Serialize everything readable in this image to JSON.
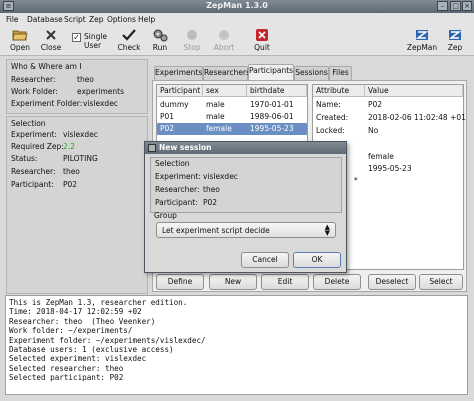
{
  "window": {
    "title": "ZepMan 1.3.0"
  },
  "menu": [
    "File",
    "Database",
    "Script",
    "Zep",
    "Options",
    "Help"
  ],
  "toolbar": {
    "open": "Open",
    "close": "Close",
    "single_user": "Single User",
    "check": "Check",
    "run": "Run",
    "stop": "Stop",
    "abort": "Abort",
    "quit": "Quit",
    "zepman": "ZepMan",
    "zep": "Zep",
    "single_user_checked": true
  },
  "who": {
    "heading": "Who & Where am I",
    "researcher_label": "Researcher:",
    "researcher": "theo",
    "work_folder_label": "Work Folder:",
    "work_folder": "experiments",
    "experiment_folder_label": "Experiment Folder:",
    "experiment_folder": "vislexdec"
  },
  "selection": {
    "heading": "Selection",
    "experiment_label": "Experiment:",
    "experiment": "vislexdec",
    "required_zep_label": "Required Zep:",
    "required_zep": "2.2",
    "status_label": "Status:",
    "status": "PILOTING",
    "researcher_label": "Researcher:",
    "researcher": "theo",
    "participant_label": "Participant:",
    "participant": "P02"
  },
  "tabs": [
    "Experiments",
    "Researchers",
    "Participants",
    "Sessions",
    "Files"
  ],
  "active_tab": "Participants",
  "participants": {
    "columns": [
      "Participant",
      "sex",
      "birthdate"
    ],
    "rows": [
      [
        "dummy",
        "male",
        "1970-01-01"
      ],
      [
        "P01",
        "male",
        "1989-06-01"
      ],
      [
        "P02",
        "female",
        "1995-05-23"
      ]
    ],
    "selected_row": 2
  },
  "attributes": {
    "columns": [
      "Attribute",
      "Value"
    ],
    "rows": [
      [
        "Name:",
        "P02"
      ],
      [
        "Created:",
        "2018-02-06 11:02:48 +01"
      ],
      [
        "Locked:",
        "No"
      ],
      [
        "",
        ""
      ],
      [
        "",
        "female"
      ],
      [
        "",
        "1995-05-23"
      ],
      [
        "*",
        ""
      ]
    ]
  },
  "buttons": {
    "define": "Define",
    "new": "New",
    "edit": "Edit",
    "delete": "Delete",
    "deselect": "Deselect",
    "select": "Select"
  },
  "console_lines": [
    "This is ZepMan 1.3, researcher edition.",
    "Time: 2018-04-17 12:02:59 +02",
    "Researcher: theo  (Theo Veenker)",
    "Work folder: ~/experiments/",
    "Experiment folder: ~/experiments/vislexdec/",
    "Database users: 1 (exclusive access)",
    "Selected experiment: vislexdec",
    "Selected researcher: theo",
    "Selected participant: P02"
  ],
  "dialog": {
    "title": "New session",
    "selection_heading": "Selection",
    "experiment_label": "Experiment:",
    "experiment": "vislexdec",
    "researcher_label": "Researcher:",
    "researcher": "theo",
    "participant_label": "Participant:",
    "participant": "P02",
    "group_heading": "Group",
    "group_value": "Let experiment script decide",
    "cancel": "Cancel",
    "ok": "OK"
  },
  "colors": {
    "selection_blue": "#6b8fc2",
    "required_zep_green": "#2e9e2e",
    "quit_red": "#c0262b"
  }
}
